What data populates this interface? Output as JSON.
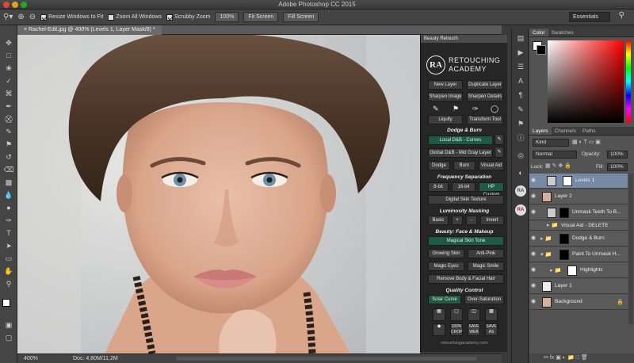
{
  "app": {
    "title": "Adobe Photoshop CC 2015"
  },
  "options_bar": {
    "resize_windows": "Resize Windows to Fit",
    "zoom_all": "Zoom All Windows",
    "scrubby_zoom": "Scrubby Zoom",
    "zoom_percent": "100%",
    "fit_screen": "Fit Screen",
    "fill_screen": "Fill Screen",
    "workspace": "Essentials"
  },
  "document": {
    "tab_title": "Rachel-Edit.jpg @ 400% (Levels 1, Layer Mask/8) *",
    "zoom": "400%",
    "doc_size": "Doc: 4,80M/11,2M"
  },
  "beauty_panel": {
    "header": "Beauty Retouch",
    "logo_top": "RETOUCHING",
    "logo_bottom": "ACADEMY",
    "logo_mark": "RA",
    "new_layer": "New Layer",
    "duplicate_layer": "Duplicate Layer",
    "sharpen_image": "Sharpen Image",
    "sharpen_details": "Sharpen Details",
    "liquify": "Liquify",
    "transform_tool": "Transform Tool",
    "dodge_burn_title": "Dodge & Burn",
    "local_db": "Local D&B - Curves",
    "global_db": "Global D&B - Mid Gray Layer",
    "dodge": "Dodge",
    "burn": "Burn",
    "visual_aid": "Visual Aid",
    "freq_title": "Frequency Separation",
    "bit8": "8-bit",
    "bit16": "16-bit",
    "hp_custom": "HP Custom",
    "digital_skin": "Digital Skin Texture",
    "lum_title": "Luminosity Masking",
    "basic": "Basic",
    "plus": "+",
    "minus": "-",
    "invert": "Invert",
    "face_title": "Beauty: Face & Makeup",
    "magical_skin": "Magical Skin Tone",
    "glowing_skin": "Glowing Skin",
    "anti_pink": "Anti-Pink",
    "magic_eyes": "Magic Eyes",
    "magic_smile": "Magic Smile",
    "remove_hair": "Remove Body & Facial Hair",
    "qc_title": "Quality Control",
    "solar_curve": "Solar Curve",
    "over_saturation": "Over-Saturation",
    "icon_100": "100% CROP",
    "icon_save_web": "SAVE WEB",
    "icon_save_as": "SAVE AS",
    "footer": "retouchingacademy.com"
  },
  "color_panel": {
    "tab_color": "Color",
    "tab_swatches": "Swatches"
  },
  "layers_panel": {
    "tab_layers": "Layers",
    "tab_channels": "Channels",
    "tab_paths": "Paths",
    "kind": "Kind",
    "blend_mode": "Normal",
    "opacity_label": "Opacity:",
    "opacity_value": "100%",
    "lock_label": "Lock:",
    "fill_label": "Fill:",
    "fill_value": "100%",
    "layers": [
      {
        "name": "Levels 1"
      },
      {
        "name": "Layer 2"
      },
      {
        "name": "Unmask Teeth To B..."
      },
      {
        "name": "Visual Aid - DELETE"
      },
      {
        "name": "Dodge & Burn"
      },
      {
        "name": "Paint To Unmask H..."
      },
      {
        "name": "Highlights"
      },
      {
        "name": "Layer 1"
      },
      {
        "name": "Background"
      }
    ]
  },
  "colors": {
    "accent_green": "#1f5a45",
    "selection": "#768aa6"
  }
}
